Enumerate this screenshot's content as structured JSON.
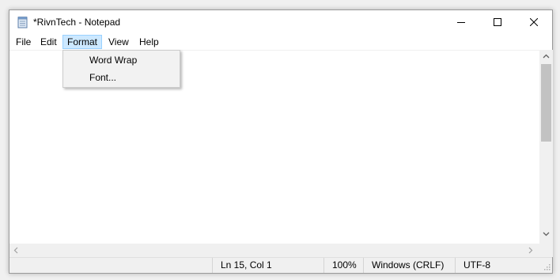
{
  "window": {
    "title": "*RivnTech - Notepad",
    "icon": "notepad-icon"
  },
  "menu": {
    "file": "File",
    "edit": "Edit",
    "format": "Format",
    "view": "View",
    "help": "Help",
    "active": "Format"
  },
  "format_menu": {
    "items": [
      "Word Wrap",
      "Font..."
    ]
  },
  "editor": {
    "content": ""
  },
  "statusbar": {
    "position": "Ln 15, Col 1",
    "zoom": "100%",
    "line_endings": "Windows (CRLF)",
    "encoding": "UTF-8"
  },
  "colors": {
    "menu_highlight": "#cce8ff",
    "menu_highlight_border": "#99d1ff",
    "dropdown_background": "#f2f2f2",
    "chrome": "#f0f0f0"
  }
}
